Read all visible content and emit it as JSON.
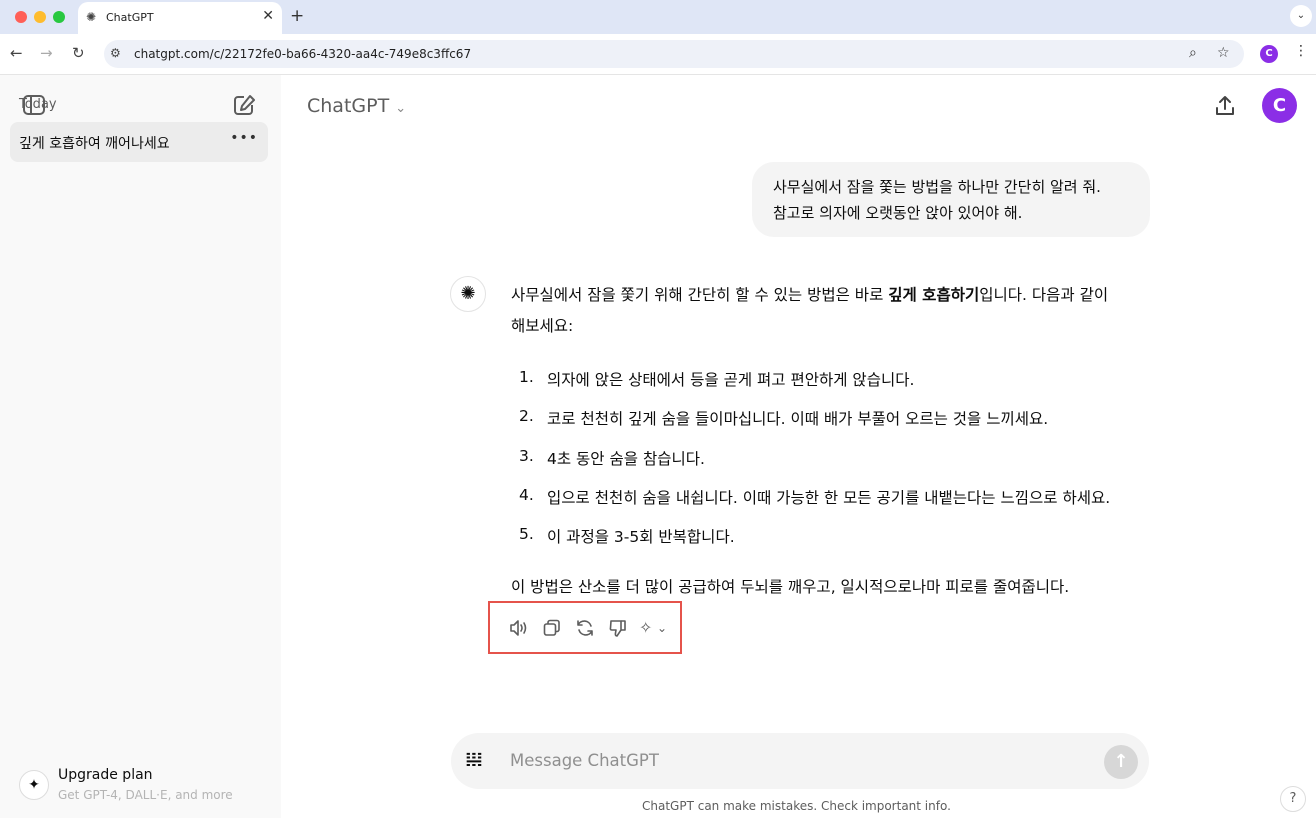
{
  "browser": {
    "tab_title": "ChatGPT",
    "url": "chatgpt.com/c/22172fe0-ba66-4320-aa4c-749e8c3ffc67",
    "profile_initial": "C"
  },
  "sidebar": {
    "section_label": "Today",
    "conversations": [
      {
        "label": "깊게 호흡하여 깨어나세요"
      }
    ],
    "upgrade": {
      "title": "Upgrade plan",
      "subtitle": "Get GPT-4, DALL·E, and more"
    }
  },
  "header": {
    "model": "ChatGPT",
    "avatar_initial": "C"
  },
  "messages": {
    "user": {
      "lines": [
        "사무실에서 잠을 쫓는 방법을 하나만 간단히 알려 줘.",
        "참고로 의자에 오랫동안 앉아 있어야 해."
      ]
    },
    "assistant": {
      "intro_before": "사무실에서 잠을 쫓기 위해 간단히 할 수 있는 방법은 바로 ",
      "intro_bold": "깊게 호흡하기",
      "intro_after": "입니다. 다음과 같이",
      "intro_line2": "해보세요:",
      "steps": [
        {
          "num": "1.",
          "text": "의자에 앉은 상태에서 등을 곧게 펴고 편안하게 앉습니다."
        },
        {
          "num": "2.",
          "text": "코로 천천히 깊게 숨을 들이마십니다. 이때 배가 부풀어 오르는 것을 느끼세요."
        },
        {
          "num": "3.",
          "text": "4초 동안 숨을 참습니다."
        },
        {
          "num": "4.",
          "text": "입으로 천천히 숨을 내쉽니다. 이때 가능한 한 모든 공기를 내뱉는다는 느낌으로 하세요."
        },
        {
          "num": "5.",
          "text": "이 과정을 3-5회 반복합니다."
        }
      ],
      "conclusion": "이 방법은 산소를 더 많이 공급하여 두뇌를 깨우고, 일시적으로나마 피로를 줄여줍니다."
    }
  },
  "composer": {
    "placeholder": "Message ChatGPT"
  },
  "footer": {
    "disclaimer": "ChatGPT can make mistakes. Check important info.",
    "help": "?"
  },
  "colors": {
    "highlight_box": "#e5534b",
    "avatar": "#8b2ee6",
    "chrome_tabbar": "#dfe6f6"
  }
}
